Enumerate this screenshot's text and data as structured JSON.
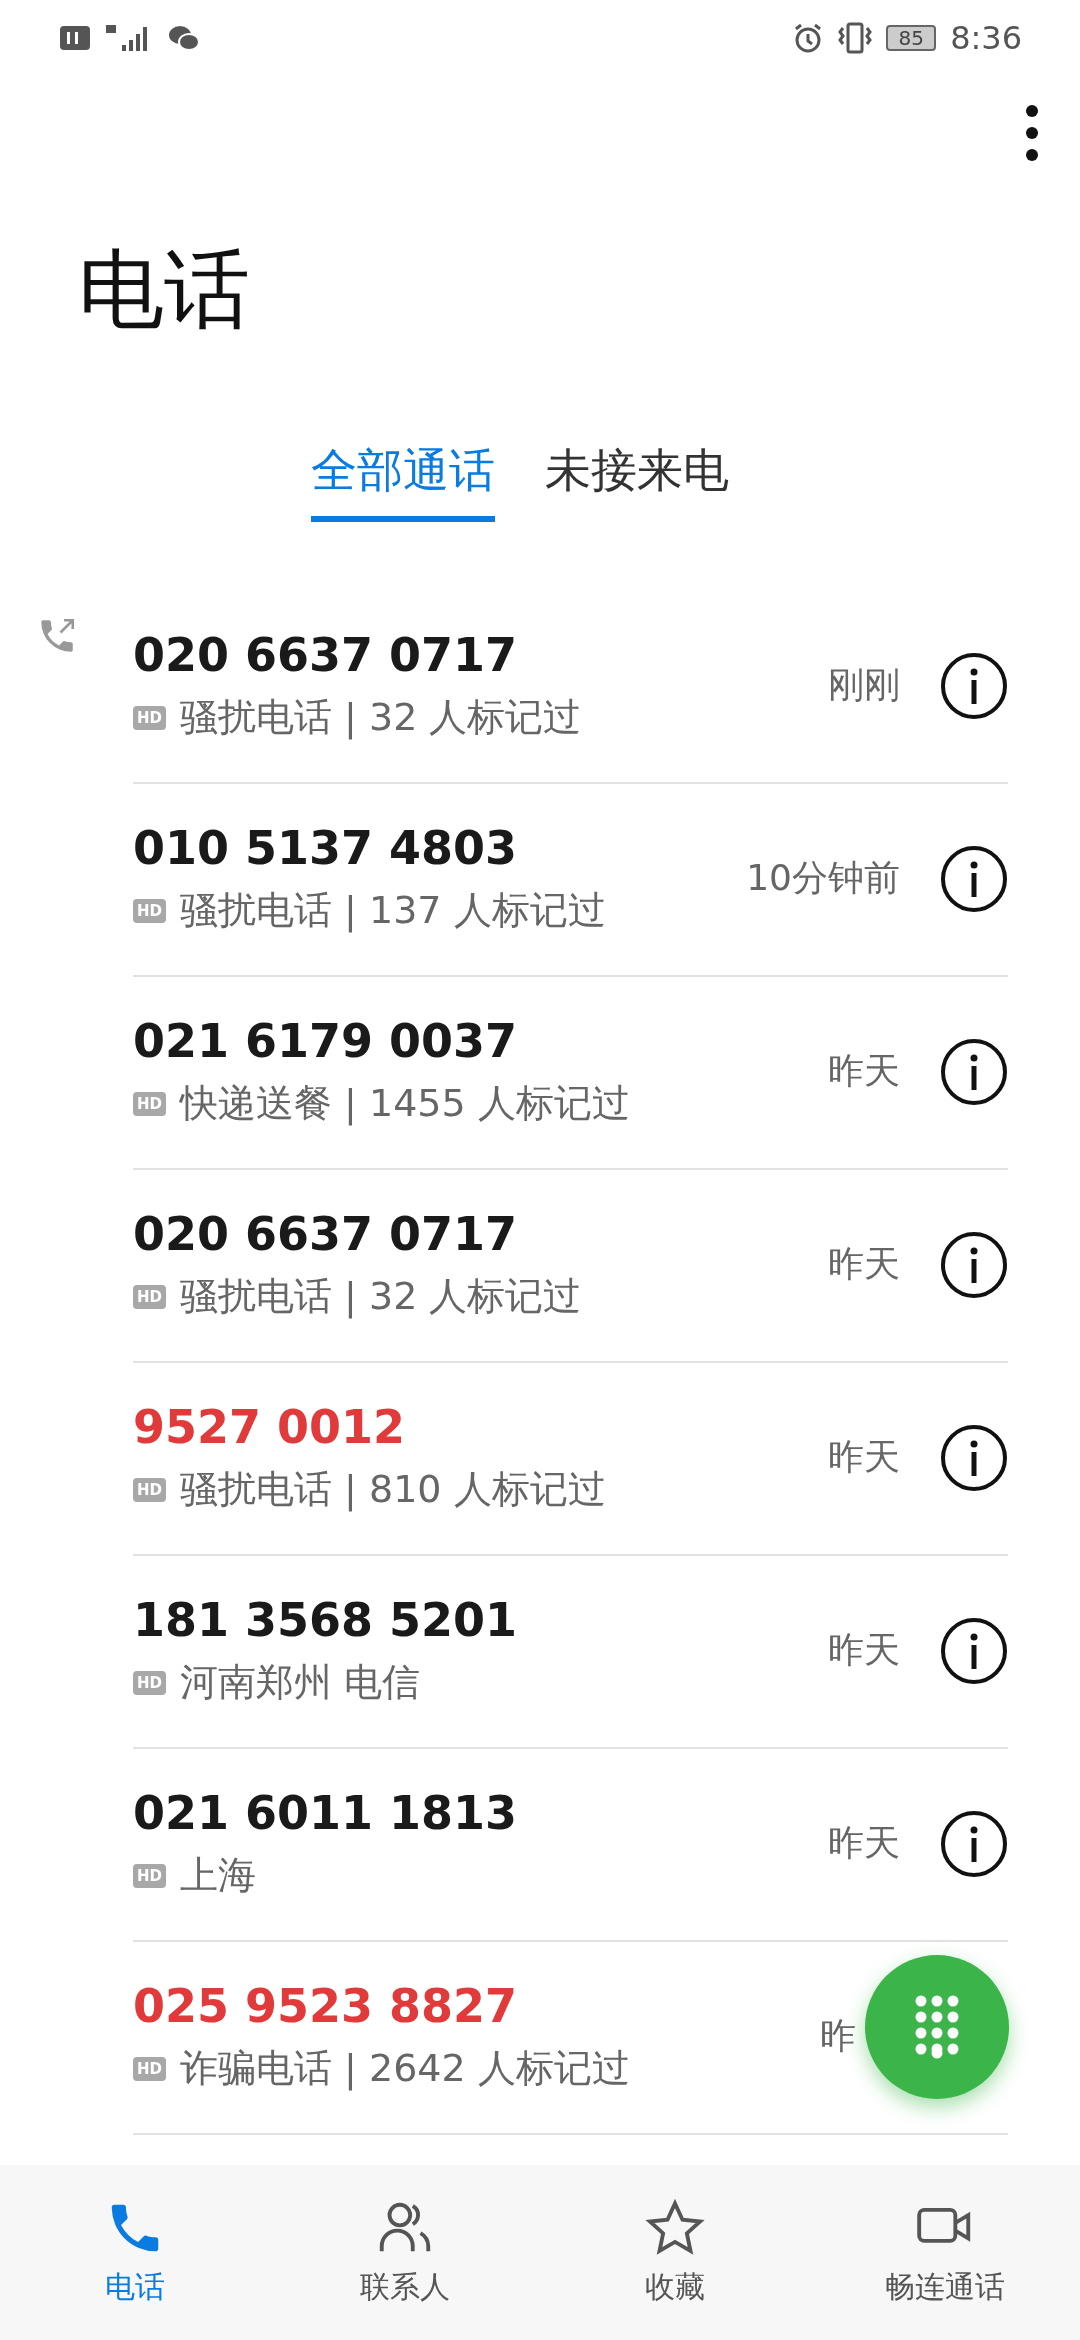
{
  "status_bar": {
    "battery": "85",
    "time": "8:36"
  },
  "title": "电话",
  "tabs": [
    {
      "label": "全部通话",
      "selected": true
    },
    {
      "label": "未接来电",
      "selected": false
    }
  ],
  "calls": [
    {
      "number": "020 6637 0717",
      "spam": false,
      "outgoing": true,
      "badge": "HD",
      "detail": "骚扰电话 | 32 人标记过",
      "time": "刚刚"
    },
    {
      "number": "010 5137 4803",
      "spam": false,
      "outgoing": false,
      "badge": "HD",
      "detail": "骚扰电话 | 137 人标记过",
      "time": "10分钟前"
    },
    {
      "number": "021 6179 0037",
      "spam": false,
      "outgoing": false,
      "badge": "HD",
      "detail": "快递送餐 | 1455 人标记过",
      "time": "昨天"
    },
    {
      "number": "020 6637 0717",
      "spam": false,
      "outgoing": false,
      "badge": "HD",
      "detail": "骚扰电话 | 32 人标记过",
      "time": "昨天"
    },
    {
      "number": "9527 0012",
      "spam": true,
      "outgoing": false,
      "badge": "HD",
      "detail": "骚扰电话 | 810 人标记过",
      "time": "昨天"
    },
    {
      "number": "181 3568 5201",
      "spam": false,
      "outgoing": false,
      "badge": "HD",
      "detail": "河南郑州 电信",
      "time": "昨天"
    },
    {
      "number": "021 6011 1813",
      "spam": false,
      "outgoing": false,
      "badge": "HD",
      "detail": "上海",
      "time": "昨天"
    },
    {
      "number": "025 9523 8827",
      "spam": true,
      "outgoing": false,
      "badge": "HD",
      "detail": "诈骗电话 | 2642 人标记过",
      "time": "昨"
    }
  ],
  "nav": [
    {
      "kind": "phone",
      "label": "电话",
      "selected": true
    },
    {
      "kind": "contacts",
      "label": "联系人",
      "selected": false
    },
    {
      "kind": "star",
      "label": "收藏",
      "selected": false
    },
    {
      "kind": "video",
      "label": "畅连通话",
      "selected": false
    }
  ]
}
